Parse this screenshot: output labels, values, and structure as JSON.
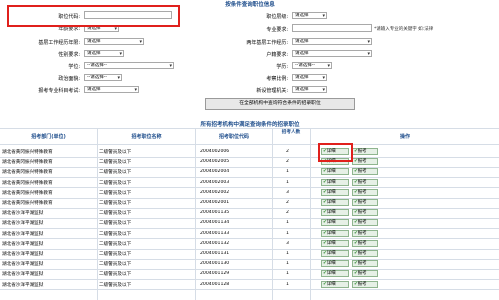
{
  "form": {
    "title": "按条件查询职位信息",
    "labels": {
      "position_code": "职位代码:",
      "position_level": "职位层级:",
      "age_requirement": "年龄要求:",
      "major_requirement": "专业要求:",
      "grassroots_years": "基层工作经历年限:",
      "two_year_grassroots": "两年基层工作经历:",
      "gender": "性别要求:",
      "household": "户籍要求:",
      "degree": "学位:",
      "education": "学历:",
      "political": "政治面貌:",
      "exam_ratio": "考察比例:",
      "specialty_exam": "报考专业科目考试:",
      "new_authority": "新设管理机关:"
    },
    "select_placeholder": "请选择",
    "select_placeholder_dash": "--请选择--",
    "major_hint": "*请输入专业的关键字 如:法律",
    "submit_label": "在全部机构中查询符合条件的招录职位"
  },
  "results": {
    "title": "所有招考机构中满足查询条件的招录职位",
    "columns": [
      "招考部门(单位)",
      "招考职位名称",
      "招考职位代码",
      "招考人数",
      "操作"
    ],
    "detail_label": "详细",
    "apply_label": "报考",
    "rows": [
      {
        "dept": "湖北省黄冈振兴特殊教育",
        "name": "二级警员及以下",
        "code": "2004002006",
        "count": "2"
      },
      {
        "dept": "湖北省黄冈振兴特殊教育",
        "name": "二级警员及以下",
        "code": "2004002005",
        "count": "2"
      },
      {
        "dept": "湖北省黄冈振兴特殊教育",
        "name": "二级警员及以下",
        "code": "2004002004",
        "count": "1"
      },
      {
        "dept": "湖北省黄冈振兴特殊教育",
        "name": "二级警员及以下",
        "code": "2004002003",
        "count": "1"
      },
      {
        "dept": "湖北省黄冈振兴特殊教育",
        "name": "二级警员及以下",
        "code": "2004002002",
        "count": "3"
      },
      {
        "dept": "湖北省黄冈振兴特殊教育",
        "name": "二级警员及以下",
        "code": "2004002001",
        "count": "2"
      },
      {
        "dept": "湖北省沙洋平湖监狱",
        "name": "二级警员及以下",
        "code": "2004001135",
        "count": "2"
      },
      {
        "dept": "湖北省沙洋平湖监狱",
        "name": "二级警员及以下",
        "code": "2004001134",
        "count": "1"
      },
      {
        "dept": "湖北省沙洋平湖监狱",
        "name": "二级警员及以下",
        "code": "2004001133",
        "count": "1"
      },
      {
        "dept": "湖北省沙洋平湖监狱",
        "name": "二级警员及以下",
        "code": "2004001132",
        "count": "3"
      },
      {
        "dept": "湖北省沙洋平湖监狱",
        "name": "二级警员及以下",
        "code": "2004001131",
        "count": "1"
      },
      {
        "dept": "湖北省沙洋平湖监狱",
        "name": "二级警员及以下",
        "code": "2004001130",
        "count": "1"
      },
      {
        "dept": "湖北省沙洋平湖监狱",
        "name": "二级警员及以下",
        "code": "2004001129",
        "count": "1"
      },
      {
        "dept": "湖北省沙洋平湖监狱",
        "name": "二级警员及以下",
        "code": "2004001128",
        "count": "1"
      }
    ]
  },
  "colors": {
    "accent_blue": "#1f4e8c",
    "highlight_red": "#e0201c",
    "action_green": "#2f8a2f"
  }
}
